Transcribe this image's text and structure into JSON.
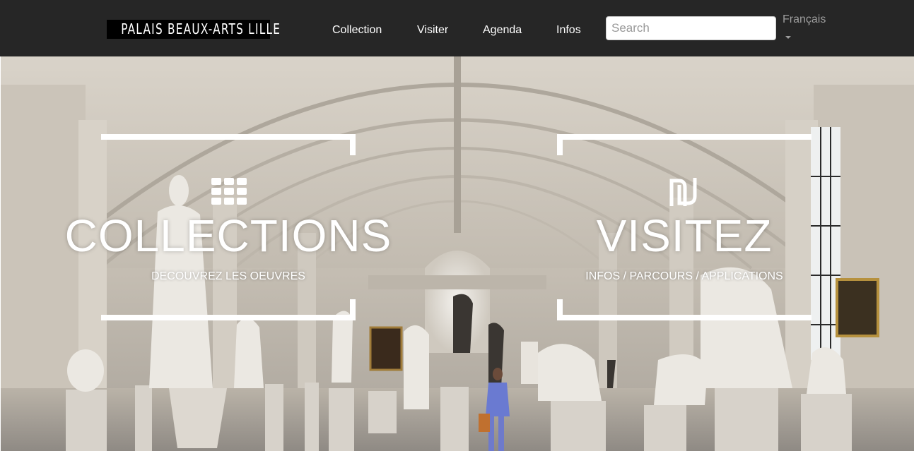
{
  "header": {
    "logo_text": "PALAIS BEAUX-ARTS LILLE",
    "nav": [
      {
        "label": "Collection"
      },
      {
        "label": "Visiter"
      },
      {
        "label": "Agenda"
      },
      {
        "label": "Infos"
      }
    ],
    "search": {
      "placeholder": "Search",
      "value": ""
    },
    "language": "Français"
  },
  "hero": {
    "collections": {
      "title": "COLLECTIONS",
      "subtitle": "DECOUVREZ LES OEUVRES",
      "icon": "grid-icon"
    },
    "visitez": {
      "title": "VISITEZ",
      "subtitle": "INFOS / PARCOURS / APPLICATIONS",
      "icon": "pba-monogram-icon"
    }
  },
  "colors": {
    "navbar": "#262626",
    "nav_text": "#ffffff",
    "lang_text": "#9d9d9d",
    "frame": "#ffffff"
  }
}
